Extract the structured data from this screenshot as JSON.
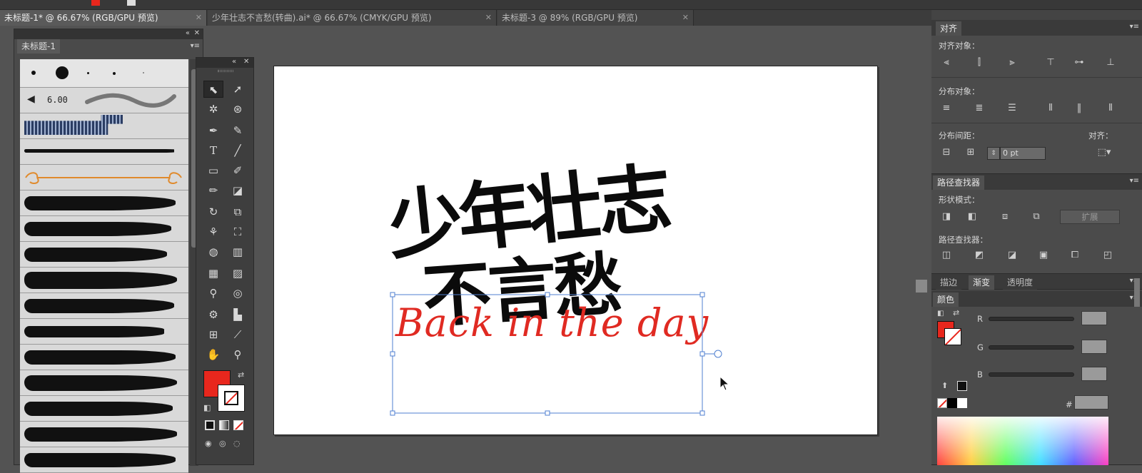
{
  "tabs": [
    {
      "label": "未标题-1* @ 66.67% (RGB/GPU 预览)",
      "active": true
    },
    {
      "label": "少年壮志不言愁(转曲).ai* @ 66.67% (CMYK/GPU 预览)",
      "active": false
    },
    {
      "label": "未标题-3 @ 89% (RGB/GPU 预览)",
      "active": false
    }
  ],
  "tab_close": "✕",
  "brush_panel": {
    "tab": "未标题-1",
    "size_value": "6.00"
  },
  "artwork": {
    "line1": "少年壮志",
    "line2": "不言愁",
    "script": "Back in the day"
  },
  "tools": {
    "type": "T"
  },
  "align_panel": {
    "tab": "对齐",
    "align_objects": "对齐对象：",
    "distribute_objects": "分布对象：",
    "distribute_spacing": "分布间距：",
    "align_to": "对齐：",
    "spacing_value": "0 pt"
  },
  "pathfinder_panel": {
    "tab": "路径查找器",
    "shape_modes": "形状模式：",
    "pathfinders": "路径查找器：",
    "expand_button": "扩展"
  },
  "lower_tabs": [
    "描边",
    "渐变",
    "透明度"
  ],
  "color_panel": {
    "tab": "颜色",
    "r_label": "R",
    "g_label": "G",
    "b_label": "B",
    "hex_label": "#"
  },
  "colors": {
    "fill": "#e8271d",
    "script_red": "#e02a22",
    "selection": "#4f7fd0",
    "ui_dark": "#3e3e3e"
  }
}
